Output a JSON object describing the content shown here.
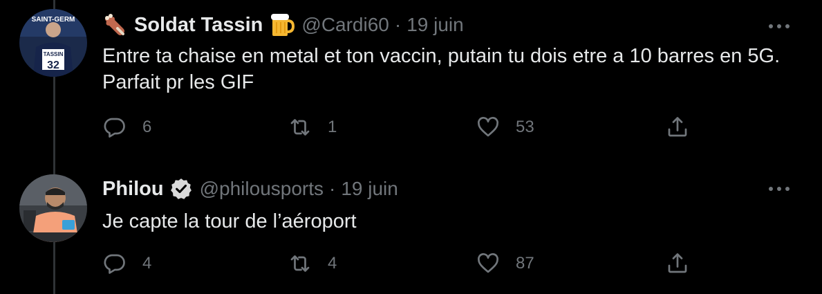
{
  "tweets": [
    {
      "name": "Soldat Tassin",
      "name_emojis": [
        "meat-icon",
        "beer-icon"
      ],
      "handle": "@Cardi60",
      "dot": "·",
      "date": "19 juin",
      "text": "Entre ta chaise en metal et ton vaccin, putain tu dois etre a 10 barres en 5G. Parfait pr les GIF",
      "avatar": {
        "jersey_name": "TASSIN",
        "jersey_number": "32",
        "banner": "SAINT-GERM"
      },
      "replies": "6",
      "retweets": "1",
      "likes": "53"
    },
    {
      "name": "Philou",
      "verified": true,
      "handle": "@philousports",
      "dot": "·",
      "date": "19 juin",
      "text": "Je capte la tour de l’aéroport",
      "replies": "4",
      "retweets": "4",
      "likes": "87"
    }
  ],
  "colors": {
    "background": "#000000",
    "primary_text": "#e7e9ea",
    "secondary_text": "#71767b",
    "thread_line": "#2f3336",
    "verified_badge": "#d9d9d9"
  }
}
